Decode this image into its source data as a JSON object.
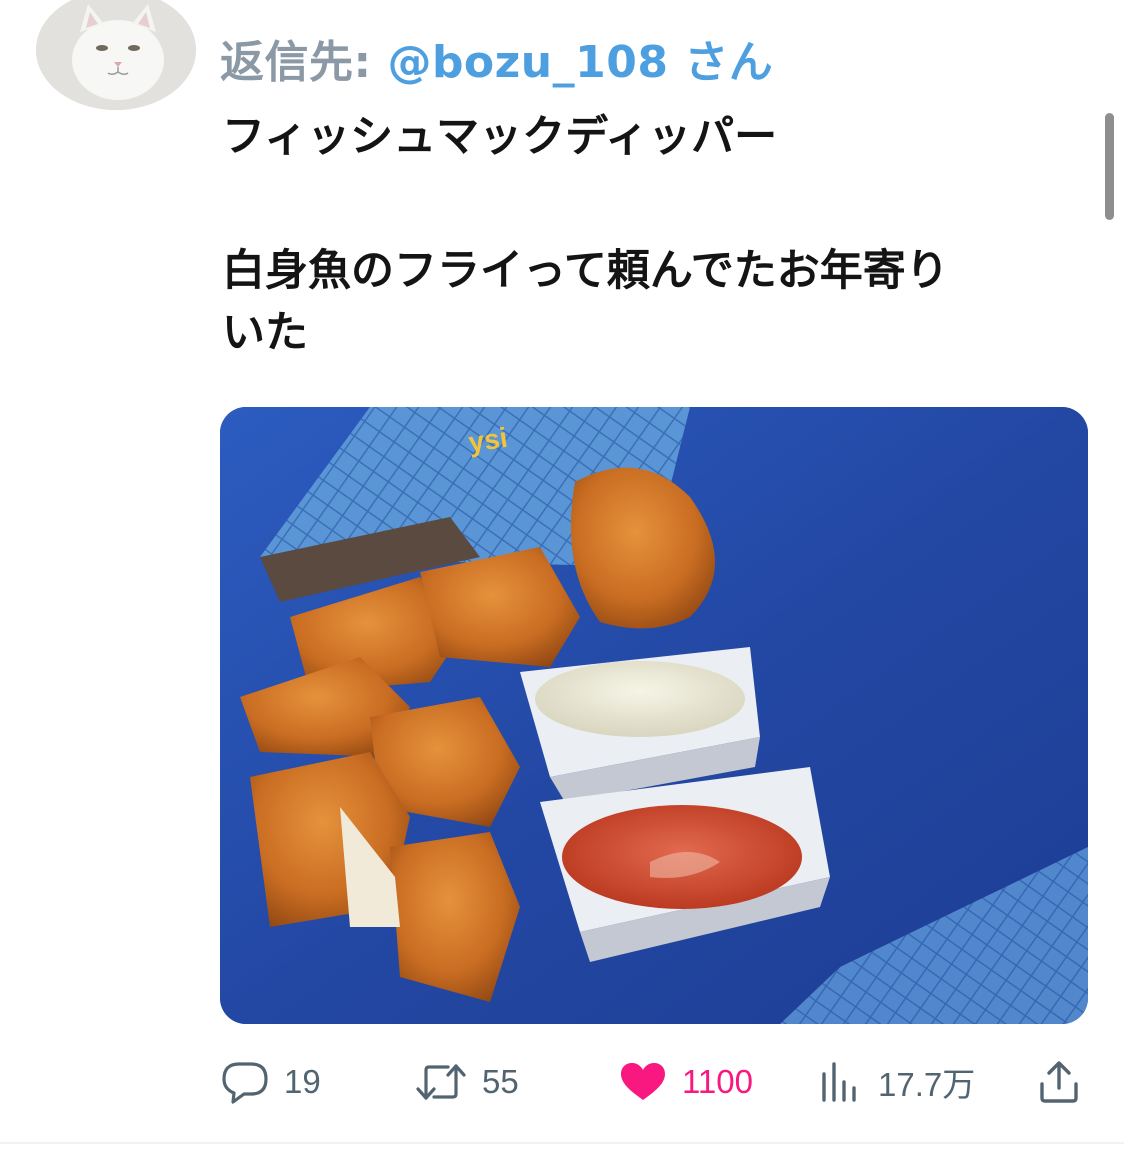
{
  "reply": {
    "prefix": "返信先:",
    "handle": "@bozu_108",
    "suffix": "さん"
  },
  "tweet": {
    "line1": "フィッシュマックディッパー",
    "line2": "白身魚のフライって頼んでたお年寄り",
    "line3": "いた"
  },
  "media": {
    "package_text": "ysi"
  },
  "actions": {
    "replies": "19",
    "retweets": "55",
    "likes": "1100",
    "views": "17.7万"
  },
  "colors": {
    "like": "#f91880",
    "handle": "#4d9fe0",
    "muted": "#536471"
  }
}
